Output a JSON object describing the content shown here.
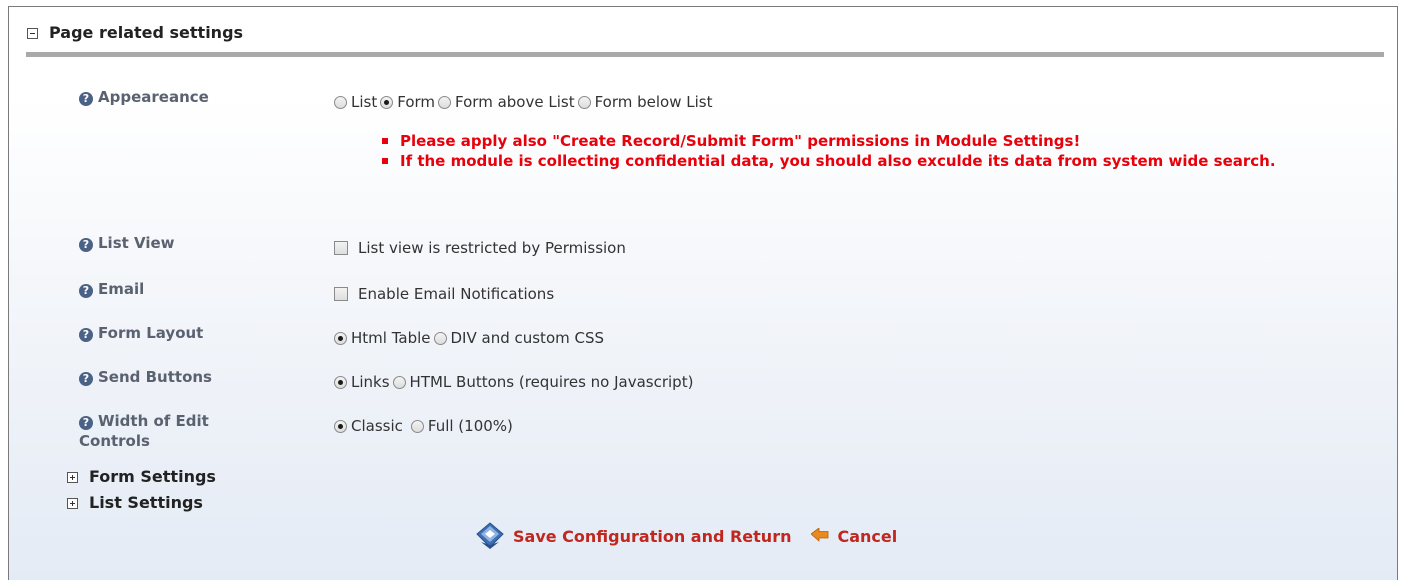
{
  "header": {
    "title": "Page related settings"
  },
  "appearance": {
    "label": "Appeareance",
    "options": [
      "List",
      "Form",
      "Form above List",
      "Form below List"
    ],
    "selected": "Form"
  },
  "warnings": [
    "Please apply also \"Create Record/Submit Form\" permissions in Module Settings!",
    "If the module is collecting confidential data, you should also exculde its data from system wide search."
  ],
  "list_view": {
    "label": "List View",
    "checkbox_label": "List view is restricted by Permission",
    "checked": false
  },
  "email": {
    "label": "Email",
    "checkbox_label": "Enable Email Notifications",
    "checked": false
  },
  "form_layout": {
    "label": "Form Layout",
    "options": [
      "Html Table",
      "DIV and custom CSS"
    ],
    "selected": "Html Table"
  },
  "send_buttons": {
    "label": "Send Buttons",
    "options": [
      "Links",
      "HTML Buttons (requires no Javascript)"
    ],
    "selected": "Links"
  },
  "edit_width": {
    "label": "Width of Edit Controls",
    "options": [
      "Classic",
      "Full (100%)"
    ],
    "selected": "Classic"
  },
  "subsections": [
    "Form Settings",
    "List Settings"
  ],
  "actions": {
    "save_label": "Save Configuration and Return",
    "cancel_label": "Cancel"
  },
  "colors": {
    "warning": "#e8000b",
    "action": "#c0271f",
    "label": "#5a6170"
  },
  "icons": {
    "help": "question-circle-icon",
    "save": "save-diskette-icon",
    "cancel": "back-arrow-icon"
  }
}
